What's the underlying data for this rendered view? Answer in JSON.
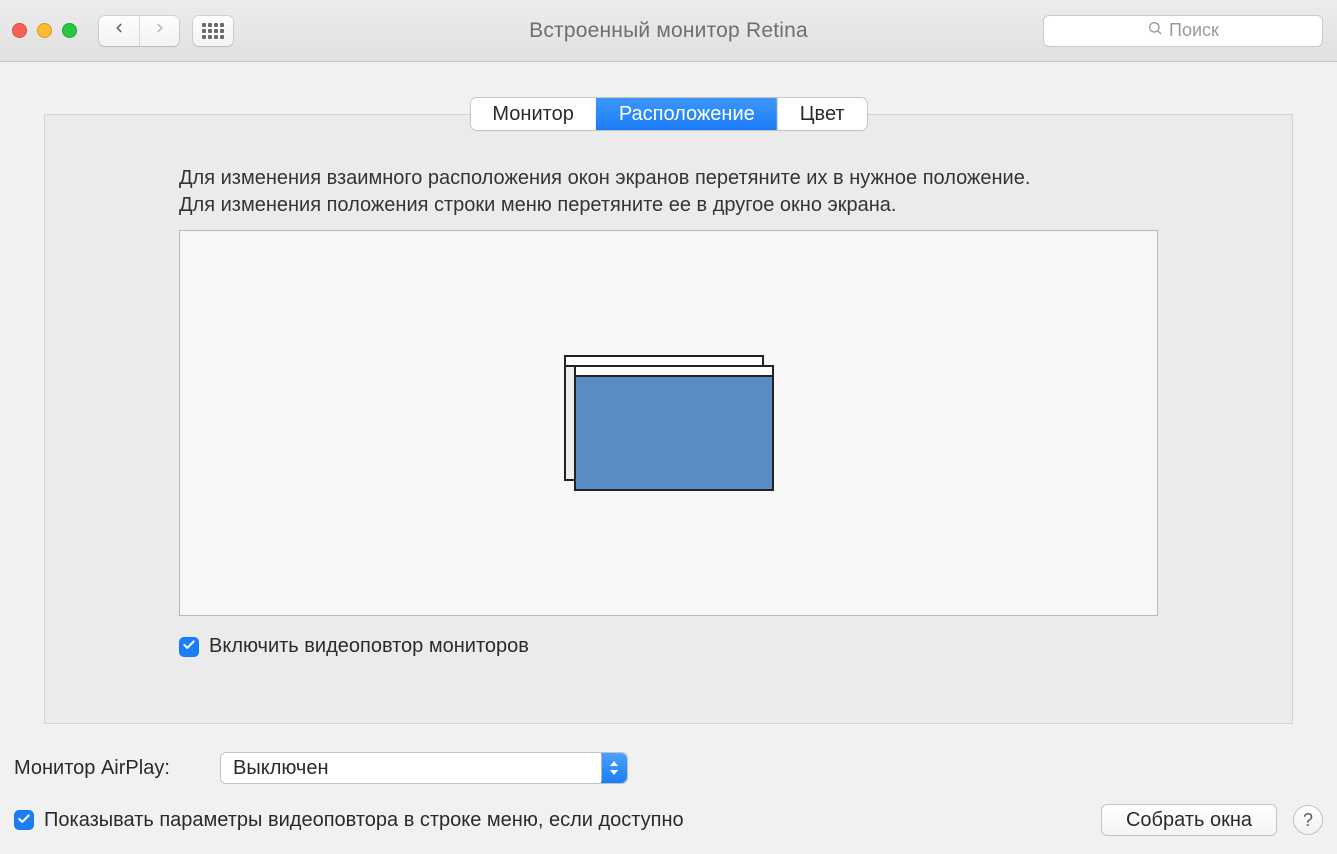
{
  "window": {
    "title": "Встроенный монитор Retina"
  },
  "toolbar": {
    "search_placeholder": "Поиск"
  },
  "tabs": {
    "monitor": "Монитор",
    "arrangement": "Расположение",
    "color": "Цвет",
    "active": "arrangement"
  },
  "instructions": {
    "line1": "Для изменения взаимного расположения окон экранов перетяните их в нужное положение.",
    "line2": "Для изменения положения строки меню перетяните ее в другое окно экрана."
  },
  "mirror": {
    "checked": true,
    "label": "Включить видеоповтор мониторов"
  },
  "airplay": {
    "label": "Монитор AirPlay:",
    "value": "Выключен"
  },
  "show_mirror_options": {
    "checked": true,
    "label": "Показывать параметры видеоповтора в строке меню, если доступно"
  },
  "gather_button": "Собрать окна",
  "help_button": "?"
}
